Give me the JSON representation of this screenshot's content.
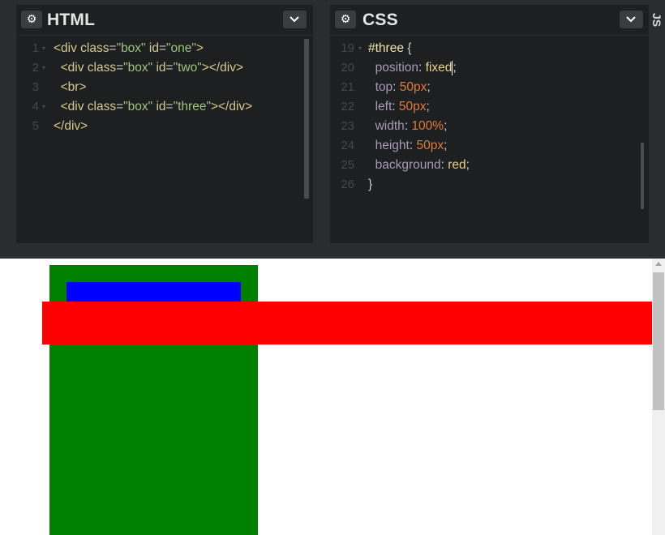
{
  "html_pane": {
    "title": "HTML",
    "gear_icon": "⚙",
    "lines": [
      {
        "num": "1",
        "fold": "▾",
        "parts": [
          {
            "t": "<div",
            "c": "c-tag"
          },
          {
            "t": " class",
            "c": "c-attr"
          },
          {
            "t": "=",
            "c": "c-plain"
          },
          {
            "t": "\"box\"",
            "c": "c-val"
          },
          {
            "t": " id",
            "c": "c-attr"
          },
          {
            "t": "=",
            "c": "c-plain"
          },
          {
            "t": "\"one\"",
            "c": "c-val"
          },
          {
            "t": ">",
            "c": "c-tag"
          }
        ]
      },
      {
        "num": "2",
        "fold": "▾",
        "parts": [
          {
            "t": "  <div",
            "c": "c-tag"
          },
          {
            "t": " class",
            "c": "c-attr"
          },
          {
            "t": "=",
            "c": "c-plain"
          },
          {
            "t": "\"box\"",
            "c": "c-val"
          },
          {
            "t": " id",
            "c": "c-attr"
          },
          {
            "t": "=",
            "c": "c-plain"
          },
          {
            "t": "\"two\"",
            "c": "c-val"
          },
          {
            "t": "></div>",
            "c": "c-tag"
          }
        ]
      },
      {
        "num": "3",
        "fold": "",
        "parts": [
          {
            "t": "  <br>",
            "c": "c-tag"
          }
        ]
      },
      {
        "num": "4",
        "fold": "▾",
        "parts": [
          {
            "t": "  <div",
            "c": "c-tag"
          },
          {
            "t": " class",
            "c": "c-attr"
          },
          {
            "t": "=",
            "c": "c-plain"
          },
          {
            "t": "\"box\"",
            "c": "c-val"
          },
          {
            "t": " id",
            "c": "c-attr"
          },
          {
            "t": "=",
            "c": "c-plain"
          },
          {
            "t": "\"three\"",
            "c": "c-val"
          },
          {
            "t": "></div>",
            "c": "c-tag"
          }
        ]
      },
      {
        "num": "5",
        "fold": "",
        "parts": [
          {
            "t": "</div>",
            "c": "c-tag"
          }
        ]
      }
    ]
  },
  "css_pane": {
    "title": "CSS",
    "gear_icon": "⚙",
    "lines": [
      {
        "num": "19",
        "fold": "▾",
        "parts": [
          {
            "t": "#three",
            "c": "c-sel"
          },
          {
            "t": " {",
            "c": "c-plain"
          }
        ]
      },
      {
        "num": "20",
        "fold": "",
        "parts": [
          {
            "t": "  position",
            "c": "c-prop"
          },
          {
            "t": ": ",
            "c": "c-plain"
          },
          {
            "t": "fixed",
            "c": "c-kw"
          },
          {
            "t": "CURSOR",
            "c": "cursor"
          },
          {
            "t": ";",
            "c": "c-plain"
          }
        ]
      },
      {
        "num": "21",
        "fold": "",
        "parts": [
          {
            "t": "  top",
            "c": "c-prop"
          },
          {
            "t": ": ",
            "c": "c-plain"
          },
          {
            "t": "50px",
            "c": "c-num"
          },
          {
            "t": ";",
            "c": "c-plain"
          }
        ]
      },
      {
        "num": "22",
        "fold": "",
        "parts": [
          {
            "t": "  left",
            "c": "c-prop"
          },
          {
            "t": ": ",
            "c": "c-plain"
          },
          {
            "t": "50px",
            "c": "c-num"
          },
          {
            "t": ";",
            "c": "c-plain"
          }
        ]
      },
      {
        "num": "23",
        "fold": "",
        "parts": [
          {
            "t": "  width",
            "c": "c-prop"
          },
          {
            "t": ": ",
            "c": "c-plain"
          },
          {
            "t": "100%",
            "c": "c-num"
          },
          {
            "t": ";",
            "c": "c-plain"
          }
        ]
      },
      {
        "num": "24",
        "fold": "",
        "parts": [
          {
            "t": "  height",
            "c": "c-prop"
          },
          {
            "t": ": ",
            "c": "c-plain"
          },
          {
            "t": "50px",
            "c": "c-num"
          },
          {
            "t": ";",
            "c": "c-plain"
          }
        ]
      },
      {
        "num": "25",
        "fold": "",
        "parts": [
          {
            "t": "  background",
            "c": "c-prop"
          },
          {
            "t": ": ",
            "c": "c-plain"
          },
          {
            "t": "red",
            "c": "c-kw"
          },
          {
            "t": ";",
            "c": "c-plain"
          }
        ]
      },
      {
        "num": "26",
        "fold": "",
        "parts": [
          {
            "t": "}",
            "c": "c-plain"
          }
        ]
      }
    ]
  },
  "js_tab": {
    "label": "JS"
  },
  "result": {
    "box_one_color": "#008000",
    "box_two_color": "#0000ff",
    "box_three_color": "#ff0000"
  }
}
